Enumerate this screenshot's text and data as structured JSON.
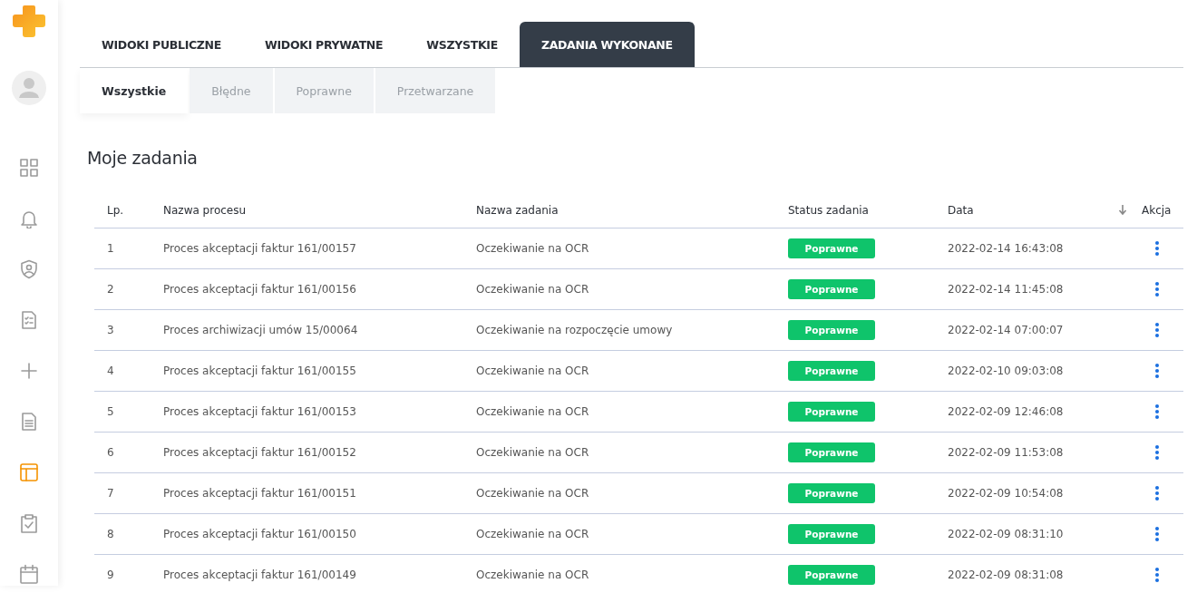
{
  "sidebar": {
    "items": [
      {
        "selected": false
      },
      {
        "selected": false
      },
      {
        "selected": false
      },
      {
        "selected": false
      },
      {
        "selected": false
      },
      {
        "selected": false
      },
      {
        "selected": true
      },
      {
        "selected": false
      },
      {
        "selected": false
      }
    ]
  },
  "tabs": [
    {
      "label": "WIDOKI PUBLICZNE",
      "selected": false
    },
    {
      "label": "WIDOKI PRYWATNE",
      "selected": false
    },
    {
      "label": "WSZYSTKIE",
      "selected": false
    },
    {
      "label": "ZADANIA WYKONANE",
      "selected": true
    }
  ],
  "subtabs": [
    {
      "label": "Wszystkie",
      "selected": true
    },
    {
      "label": "Błędne",
      "selected": false
    },
    {
      "label": "Poprawne",
      "selected": false
    },
    {
      "label": "Przetwarzane",
      "selected": false
    }
  ],
  "section_title": "Moje zadania",
  "table": {
    "columns": [
      {
        "label": "Lp.",
        "sorted": false
      },
      {
        "label": "Nazwa procesu",
        "sorted": false
      },
      {
        "label": "Nazwa zadania",
        "sorted": false
      },
      {
        "label": "Status zadania",
        "sorted": false
      },
      {
        "label": "Data",
        "sorted": true
      },
      {
        "label": "Akcja",
        "sorted": false
      }
    ],
    "rows": [
      {
        "lp": "1",
        "process": "Proces akceptacji faktur 161/00157",
        "task": "Oczekiwanie na OCR",
        "status": {
          "label": "Poprawne",
          "kind": "success"
        },
        "date": "2022-02-14 16:43:08"
      },
      {
        "lp": "2",
        "process": "Proces akceptacji faktur 161/00156",
        "task": "Oczekiwanie na OCR",
        "status": {
          "label": "Poprawne",
          "kind": "success"
        },
        "date": "2022-02-14 11:45:08"
      },
      {
        "lp": "3",
        "process": "Proces archiwizacji umów 15/00064",
        "task": "Oczekiwanie na rozpoczęcie umowy",
        "status": {
          "label": "Poprawne",
          "kind": "success"
        },
        "date": "2022-02-14 07:00:07"
      },
      {
        "lp": "4",
        "process": "Proces akceptacji faktur 161/00155",
        "task": "Oczekiwanie na OCR",
        "status": {
          "label": "Poprawne",
          "kind": "success"
        },
        "date": "2022-02-10 09:03:08"
      },
      {
        "lp": "5",
        "process": "Proces akceptacji faktur 161/00153",
        "task": "Oczekiwanie na OCR",
        "status": {
          "label": "Poprawne",
          "kind": "success"
        },
        "date": "2022-02-09 12:46:08"
      },
      {
        "lp": "6",
        "process": "Proces akceptacji faktur 161/00152",
        "task": "Oczekiwanie na OCR",
        "status": {
          "label": "Poprawne",
          "kind": "success"
        },
        "date": "2022-02-09 11:53:08"
      },
      {
        "lp": "7",
        "process": "Proces akceptacji faktur 161/00151",
        "task": "Oczekiwanie na OCR",
        "status": {
          "label": "Poprawne",
          "kind": "success"
        },
        "date": "2022-02-09 10:54:08"
      },
      {
        "lp": "8",
        "process": "Proces akceptacji faktur 161/00150",
        "task": "Oczekiwanie na OCR",
        "status": {
          "label": "Poprawne",
          "kind": "success"
        },
        "date": "2022-02-09 08:31:10"
      },
      {
        "lp": "9",
        "process": "Proces akceptacji faktur 161/00149",
        "task": "Oczekiwanie na OCR",
        "status": {
          "label": "Poprawne",
          "kind": "success"
        },
        "date": "2022-02-09 08:31:08"
      }
    ]
  }
}
